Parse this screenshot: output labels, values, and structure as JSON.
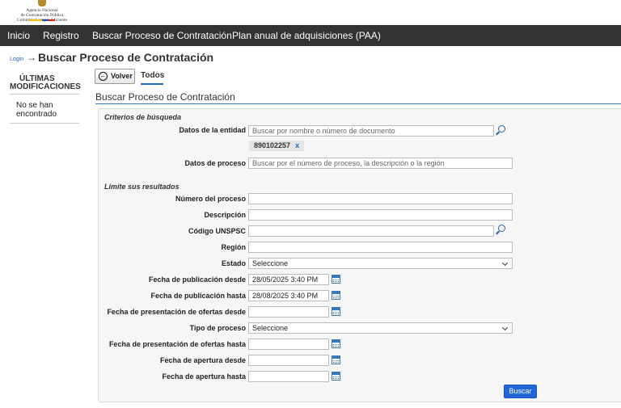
{
  "logo": {
    "line1": "Agencia Nacional",
    "line2": "de Contratación Pública",
    "line3": "Colombia Compra Eficiente"
  },
  "nav": {
    "items": [
      {
        "label": "Inicio"
      },
      {
        "label": "Registro"
      },
      {
        "label": "Buscar Proceso de Contratación"
      },
      {
        "label": "Plan anual de adquisiciones (PAA)"
      }
    ]
  },
  "breadcrumb": {
    "login": "Login",
    "arrow": "→",
    "title": "Buscar Proceso de Contratación"
  },
  "sidebar": {
    "title_line1": "ÚLTIMAS",
    "title_line2": "MODIFICACIONES",
    "empty_line1": "No se han",
    "empty_line2": "encontrado"
  },
  "toolbar": {
    "back_label": "Volver",
    "tab_label": "Todos"
  },
  "section_title": "Buscar Proceso de Contratación",
  "form": {
    "criteria_title": "Criterios de búsqueda",
    "entity_label": "Datos de la entidad",
    "entity_placeholder": "Buscar por nombre o número de documento",
    "entity_tag": "890102257",
    "entity_tag_remove": "x",
    "process_label": "Datos de proceso",
    "process_placeholder": "Buscar por el número de proceso, la descripción o la región",
    "limit_title": "Limite sus resultados",
    "fields": {
      "numero_label": "Número del proceso",
      "descripcion_label": "Descripción",
      "unspsc_label": "Código UNSPSC",
      "region_label": "Región",
      "estado_label": "Estado",
      "estado_value": "Seleccione",
      "pub_desde_label": "Fecha de publicación desde",
      "pub_desde_value": "28/05/2025 3:40 PM",
      "pub_hasta_label": "Fecha de publicación hasta",
      "pub_hasta_value": "28/08/2025 3:40 PM",
      "ofertas_desde_label": "Fecha de presentación de ofertas desde",
      "tipo_label": "Tipo de proceso",
      "tipo_value": "Seleccione",
      "ofertas_hasta_label": "Fecha de presentación de ofertas hasta",
      "apertura_desde_label": "Fecha de apertura desde",
      "apertura_hasta_label": "Fecha de apertura hasta"
    },
    "search_button": "Buscar"
  },
  "colors": {
    "nav_bg": "#333333",
    "accent": "#1f66d9",
    "link": "#1f66c1"
  }
}
